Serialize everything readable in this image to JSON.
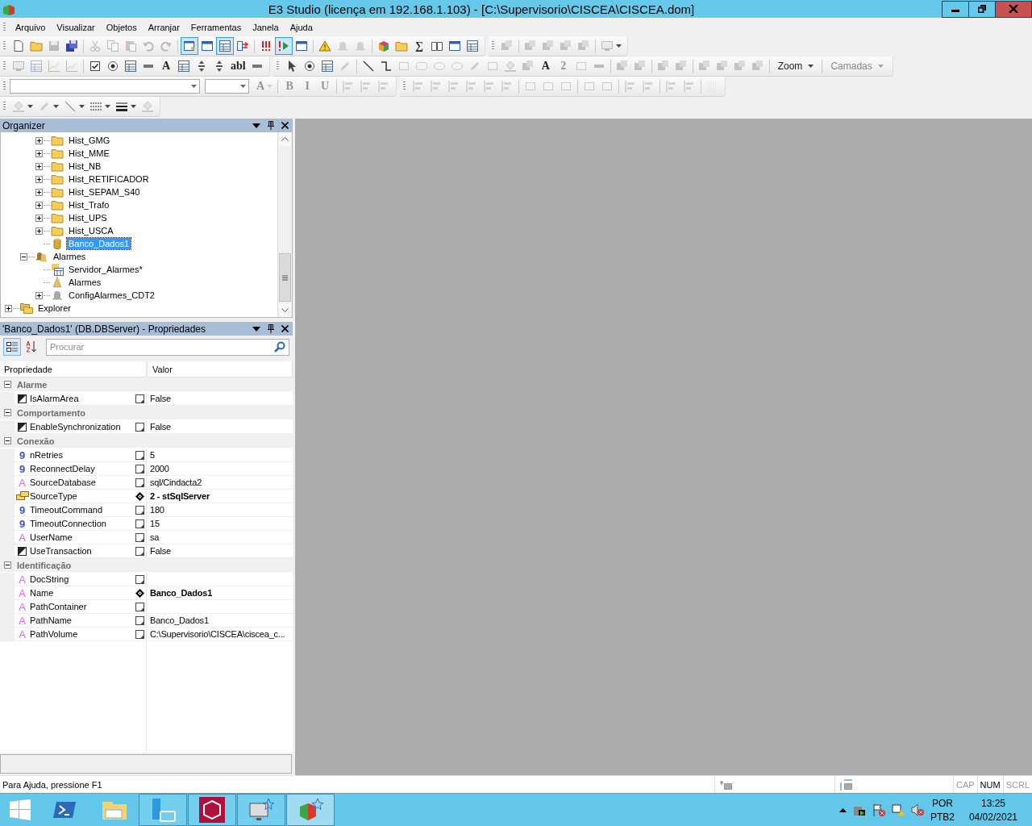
{
  "window": {
    "title": "E3 Studio (licença em 192.168.1.103) - [C:\\Supervisorio\\CISCEA\\CISCEA.dom]"
  },
  "menu": [
    "Arquivo",
    "Visualizar",
    "Objetos",
    "Arranjar",
    "Ferramentas",
    "Janela",
    "Ajuda"
  ],
  "toolbar_rows": [
    [
      {
        "items": [
          {
            "kind": "doc",
            "pressed": false,
            "disabled": false
          },
          {
            "kind": "folder",
            "pressed": false,
            "disabled": false
          },
          {
            "kind": "disk",
            "pressed": false,
            "disabled": true
          },
          {
            "kind": "disks",
            "pressed": false,
            "disabled": false
          },
          {
            "kind": "sep"
          },
          {
            "kind": "scissors",
            "pressed": false,
            "disabled": true
          },
          {
            "kind": "copy",
            "pressed": false,
            "disabled": true
          },
          {
            "kind": "clipboard",
            "pressed": false,
            "disabled": true
          },
          {
            "kind": "undo",
            "pressed": false,
            "disabled": true
          },
          {
            "kind": "redo",
            "pressed": false,
            "disabled": true
          },
          {
            "kind": "sep"
          },
          {
            "kind": "form",
            "pressed": true,
            "disabled": false
          },
          {
            "kind": "window",
            "pressed": false,
            "disabled": false
          },
          {
            "kind": "table",
            "pressed": true,
            "disabled": false
          },
          {
            "kind": "swap",
            "pressed": false,
            "disabled": false
          },
          {
            "kind": "sep"
          },
          {
            "kind": "exclaim",
            "pressed": false,
            "disabled": false
          },
          {
            "kind": "play",
            "pressed": true,
            "disabled": false
          },
          {
            "kind": "window",
            "pressed": false,
            "disabled": false
          },
          {
            "kind": "sep"
          },
          {
            "kind": "warning",
            "pressed": false,
            "disabled": false
          },
          {
            "kind": "bell",
            "pressed": false,
            "disabled": true
          },
          {
            "kind": "bell",
            "pressed": false,
            "disabled": true
          },
          {
            "kind": "sep"
          },
          {
            "kind": "cube",
            "pressed": false,
            "disabled": false
          },
          {
            "kind": "folder",
            "pressed": false,
            "disabled": false
          },
          {
            "kind": "glyph",
            "label": "∑",
            "pressed": false,
            "disabled": false
          },
          {
            "kind": "book",
            "pressed": false,
            "disabled": false
          },
          {
            "kind": "window",
            "pressed": false,
            "disabled": false
          },
          {
            "kind": "table",
            "pressed": false,
            "disabled": false
          }
        ]
      },
      {
        "items": [
          {
            "kind": "squares",
            "pressed": false,
            "disabled": true
          },
          {
            "kind": "sep"
          },
          {
            "kind": "squares",
            "pressed": false,
            "disabled": true
          },
          {
            "kind": "squares",
            "pressed": false,
            "disabled": true
          },
          {
            "kind": "squares",
            "pressed": false,
            "disabled": true
          },
          {
            "kind": "squares",
            "pressed": false,
            "disabled": true
          },
          {
            "kind": "sep"
          },
          {
            "kind": "monitor",
            "pressed": false,
            "disabled": true,
            "dropdown": true
          }
        ]
      }
    ],
    [
      {
        "items": [
          {
            "kind": "monitor",
            "pressed": false,
            "disabled": true
          },
          {
            "kind": "table",
            "pressed": false,
            "disabled": true
          },
          {
            "kind": "chart",
            "pressed": false,
            "disabled": true
          },
          {
            "kind": "chart",
            "pressed": false,
            "disabled": true
          },
          {
            "kind": "sep"
          },
          {
            "kind": "checkbox",
            "pressed": false,
            "disabled": false
          },
          {
            "kind": "radio",
            "pressed": false,
            "disabled": false
          },
          {
            "kind": "table",
            "pressed": false,
            "disabled": false
          },
          {
            "kind": "bar",
            "pressed": false,
            "disabled": false
          },
          {
            "kind": "glyph",
            "label": "A",
            "pressed": false,
            "disabled": false
          },
          {
            "kind": "table",
            "pressed": false,
            "disabled": false
          },
          {
            "kind": "spin",
            "pressed": false,
            "disabled": false
          },
          {
            "kind": "spin",
            "pressed": false,
            "disabled": false
          },
          {
            "kind": "glyph",
            "label": "abl",
            "pressed": false,
            "disabled": false
          },
          {
            "kind": "bar",
            "pressed": false,
            "disabled": false
          }
        ]
      },
      {
        "items": [
          {
            "kind": "pointer",
            "pressed": false,
            "disabled": false
          },
          {
            "kind": "radio",
            "pressed": false,
            "disabled": false
          },
          {
            "kind": "table",
            "pressed": false,
            "disabled": false
          },
          {
            "kind": "pencil",
            "pressed": false,
            "disabled": true
          },
          {
            "kind": "sep"
          },
          {
            "kind": "line",
            "pressed": false,
            "disabled": false
          },
          {
            "kind": "connector",
            "pressed": false,
            "disabled": false
          },
          {
            "kind": "rect",
            "pressed": false,
            "disabled": true
          },
          {
            "kind": "roundrect",
            "pressed": false,
            "disabled": true
          },
          {
            "kind": "ellipse",
            "pressed": false,
            "disabled": true
          },
          {
            "kind": "ellipse",
            "pressed": false,
            "disabled": true
          },
          {
            "kind": "pencil",
            "pressed": false,
            "disabled": true
          },
          {
            "kind": "rect",
            "pressed": false,
            "disabled": true
          },
          {
            "kind": "bucket",
            "pressed": false,
            "disabled": true
          },
          {
            "kind": "squares",
            "pressed": false,
            "disabled": true
          },
          {
            "kind": "glyph",
            "label": "A",
            "pressed": false,
            "disabled": false
          },
          {
            "kind": "glyph",
            "label": "2",
            "pressed": false,
            "disabled": true
          },
          {
            "kind": "rect",
            "pressed": false,
            "disabled": true
          },
          {
            "kind": "bar",
            "pressed": false,
            "disabled": true
          },
          {
            "kind": "sep"
          },
          {
            "kind": "squares",
            "pressed": false,
            "disabled": true
          },
          {
            "kind": "squares",
            "pressed": false,
            "disabled": true
          },
          {
            "kind": "sep"
          },
          {
            "kind": "squares",
            "pressed": false,
            "disabled": true
          },
          {
            "kind": "squares",
            "pressed": false,
            "disabled": true
          },
          {
            "kind": "sep"
          },
          {
            "kind": "squares",
            "pressed": false,
            "disabled": true
          },
          {
            "kind": "squares",
            "pressed": false,
            "disabled": true
          },
          {
            "kind": "squares",
            "pressed": false,
            "disabled": true
          },
          {
            "kind": "squares",
            "pressed": false,
            "disabled": true
          },
          {
            "kind": "sep"
          },
          {
            "kind": "menu",
            "label": "Zoom",
            "pressed": false,
            "disabled": false
          },
          {
            "kind": "sep"
          },
          {
            "kind": "menu",
            "label": "Camadas",
            "pressed": false,
            "disabled": true
          }
        ]
      }
    ],
    [
      {
        "items": [
          {
            "kind": "fontbox",
            "pressed": false,
            "disabled": false
          },
          {
            "kind": "sizebox",
            "pressed": false,
            "disabled": false
          },
          {
            "kind": "glyph",
            "label": "A",
            "pressed": false,
            "disabled": true,
            "dropdown": true
          },
          {
            "kind": "sep"
          },
          {
            "kind": "glyph",
            "label": "B",
            "pressed": false,
            "disabled": true
          },
          {
            "kind": "glyph",
            "label": "I",
            "pressed": false,
            "disabled": true
          },
          {
            "kind": "glyph",
            "label": "U",
            "pressed": false,
            "disabled": true
          },
          {
            "kind": "sep"
          },
          {
            "kind": "align",
            "pressed": false,
            "disabled": true
          },
          {
            "kind": "align",
            "pressed": false,
            "disabled": true
          },
          {
            "kind": "align",
            "pressed": false,
            "disabled": true
          }
        ]
      },
      {
        "items": [
          {
            "kind": "align",
            "pressed": false,
            "disabled": true
          },
          {
            "kind": "align",
            "pressed": false,
            "disabled": true
          },
          {
            "kind": "align",
            "pressed": false,
            "disabled": true
          },
          {
            "kind": "align",
            "pressed": false,
            "disabled": true
          },
          {
            "kind": "align",
            "pressed": false,
            "disabled": true
          },
          {
            "kind": "align",
            "pressed": false,
            "disabled": true
          },
          {
            "kind": "sep"
          },
          {
            "kind": "rect",
            "pressed": false,
            "disabled": true
          },
          {
            "kind": "rect",
            "pressed": false,
            "disabled": true
          },
          {
            "kind": "rect",
            "pressed": false,
            "disabled": true
          },
          {
            "kind": "sep"
          },
          {
            "kind": "rect",
            "pressed": false,
            "disabled": true
          },
          {
            "kind": "rect",
            "pressed": false,
            "disabled": true
          },
          {
            "kind": "sep"
          },
          {
            "kind": "align",
            "pressed": false,
            "disabled": true
          },
          {
            "kind": "align",
            "pressed": false,
            "disabled": true
          },
          {
            "kind": "sep"
          },
          {
            "kind": "align",
            "pressed": false,
            "disabled": true
          },
          {
            "kind": "align",
            "pressed": false,
            "disabled": true
          },
          {
            "kind": "sep"
          },
          {
            "kind": "grid",
            "pressed": false,
            "disabled": true
          }
        ]
      }
    ],
    [
      {
        "items": [
          {
            "kind": "bucket",
            "pressed": false,
            "disabled": true,
            "dropdown": true
          },
          {
            "kind": "pencil",
            "pressed": false,
            "disabled": true,
            "dropdown": true
          },
          {
            "kind": "line",
            "pressed": false,
            "disabled": true,
            "dropdown": true
          },
          {
            "kind": "dashes",
            "pressed": false,
            "disabled": false,
            "dropdown": true
          },
          {
            "kind": "lines",
            "pressed": false,
            "disabled": false,
            "dropdown": true
          },
          {
            "kind": "bucket",
            "pressed": false,
            "disabled": true
          }
        ]
      }
    ]
  ],
  "organizer": {
    "title": "Organizer",
    "tree": [
      {
        "children": [
          {
            "children": [
              {
                "label": "Hist_GMG",
                "kind": "folder",
                "expanded": false,
                "selected": false
              },
              {
                "label": "Hist_MME",
                "kind": "folder",
                "expanded": false,
                "selected": false
              },
              {
                "label": "Hist_NB",
                "kind": "folder",
                "expanded": false,
                "selected": false
              },
              {
                "label": "Hist_RETIFICADOR",
                "kind": "folder",
                "expanded": false,
                "selected": false
              },
              {
                "label": "Hist_SEPAM_S40",
                "kind": "folder",
                "expanded": false,
                "selected": false
              },
              {
                "label": "Hist_Trafo",
                "kind": "folder",
                "expanded": false,
                "selected": false
              },
              {
                "label": "Hist_UPS",
                "kind": "folder",
                "expanded": false,
                "selected": false
              },
              {
                "label": "Hist_USCA",
                "kind": "folder",
                "expanded": false,
                "selected": false
              },
              {
                "label": "Banco_Dados1",
                "kind": "database",
                "selected": true
              }
            ]
          },
          {
            "label": "Alarmes",
            "kind": "bells",
            "expanded": true,
            "selected": false,
            "children": [
              {
                "label": "Servidor_Alarmes*",
                "kind": "server",
                "selected": false
              },
              {
                "label": "Alarmes",
                "kind": "tree",
                "selected": false
              },
              {
                "label": "ConfigAlarmes_CDT2",
                "kind": "bell",
                "expanded": false,
                "selected": false
              }
            ]
          }
        ]
      },
      {
        "label": "Explorer",
        "kind": "folders",
        "expanded": false,
        "selected": false
      }
    ]
  },
  "properties": {
    "title": "'Banco_Dados1' (DB.DBServer) - Propriedades",
    "view_buttons": [
      {
        "kind": "categorized",
        "selected": true
      },
      {
        "kind": "alphabetical",
        "selected": false
      }
    ],
    "search": {
      "placeholder": "Procurar"
    },
    "columns": [
      "Propriedade",
      "Valor"
    ],
    "categories": [
      {
        "name": "Alarme",
        "expanded": true,
        "rows": [
          {
            "name": "IsAlarmArea",
            "kind": "bool",
            "value": "False",
            "modified": false
          }
        ]
      },
      {
        "name": "Comportamento",
        "expanded": true,
        "rows": [
          {
            "name": "EnableSynchronization",
            "kind": "bool",
            "value": "False",
            "modified": false
          }
        ]
      },
      {
        "name": "Conexão",
        "expanded": true,
        "rows": [
          {
            "name": "nRetries",
            "kind": "number",
            "symbol": "9",
            "value": "5",
            "modified": false
          },
          {
            "name": "ReconnectDelay",
            "kind": "number",
            "symbol": "9",
            "value": "2000",
            "modified": false
          },
          {
            "name": "SourceDatabase",
            "kind": "text",
            "symbol": "A",
            "value": "sql/Cindacta2",
            "modified": false
          },
          {
            "name": "SourceType",
            "kind": "enum",
            "value": "2 - stSqlServer",
            "modified": true
          },
          {
            "name": "TimeoutCommand",
            "kind": "number",
            "symbol": "9",
            "value": "180",
            "modified": false
          },
          {
            "name": "TimeoutConnection",
            "kind": "number",
            "symbol": "9",
            "value": "15",
            "modified": false
          },
          {
            "name": "UserName",
            "kind": "text",
            "symbol": "A",
            "value": "sa",
            "modified": false
          },
          {
            "name": "UseTransaction",
            "kind": "bool",
            "value": "False",
            "modified": false
          }
        ]
      },
      {
        "name": "Identificação",
        "expanded": true,
        "rows": [
          {
            "name": "DocString",
            "kind": "text",
            "symbol": "A",
            "modified": false
          },
          {
            "name": "Name",
            "kind": "text",
            "symbol": "A",
            "value": "Banco_Dados1",
            "modified": true
          },
          {
            "name": "PathContainer",
            "kind": "text",
            "symbol": "A",
            "modified": false
          },
          {
            "name": "PathName",
            "kind": "text",
            "symbol": "A",
            "value": "Banco_Dados1",
            "modified": false
          },
          {
            "name": "PathVolume",
            "kind": "text",
            "symbol": "A",
            "value": "C:\\Supervisorio\\CISCEA\\ciscea_c...",
            "modified": false
          }
        ]
      }
    ]
  },
  "status_bar": {
    "text": "Para Ajuda, pressione F1",
    "indicators": [
      {
        "label": "CAP",
        "on": false
      },
      {
        "label": "NUM",
        "on": true
      },
      {
        "label": "SCRL",
        "on": false
      }
    ]
  },
  "taskbar": {
    "apps": [
      {
        "kind": "powershell",
        "active": false
      },
      {
        "kind": "explorer",
        "active": false
      },
      {
        "kind": "server",
        "active": true
      },
      {
        "kind": "puzzle",
        "active": true
      },
      {
        "kind": "monitor",
        "active": true
      },
      {
        "kind": "e3",
        "active": true,
        "selected": true
      }
    ],
    "language": [
      "POR",
      "PTB2"
    ],
    "time": "13:25",
    "date": "04/02/2021"
  }
}
